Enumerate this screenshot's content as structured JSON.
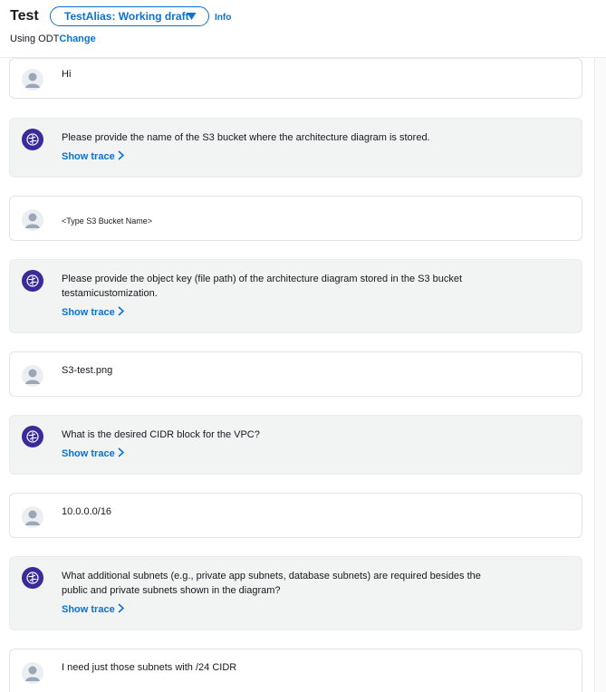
{
  "header": {
    "title": "Test",
    "alias_selected": "TestAlias: Working draft",
    "info_label": "Info",
    "using_prefix": "Using ODT",
    "change_label": "Change"
  },
  "colors": {
    "accent": "#0972d3",
    "agent_bubble": "#f2f3f3",
    "bot_avatar": "#3b2a99"
  },
  "icons": {
    "user_avatar": "user-avatar-icon",
    "bot_avatar": "agent-brain-icon",
    "trace_chevron": "chevron-right-icon",
    "dropdown_caret": "caret-down-icon"
  },
  "messages": [
    {
      "role": "user",
      "text": "Hi"
    },
    {
      "role": "agent",
      "text": "Please provide the name of the S3 bucket where the architecture diagram is stored.",
      "trace": "Show trace"
    },
    {
      "role": "user",
      "text": "<Type S3 Bucket Name>"
    },
    {
      "role": "agent",
      "text": "Please provide the object key (file path) of the architecture diagram stored in the S3 bucket testamicustomization.",
      "trace": "Show trace"
    },
    {
      "role": "user",
      "text": "S3-test.png"
    },
    {
      "role": "agent",
      "text": "What is the desired CIDR block for the VPC?",
      "trace": "Show trace"
    },
    {
      "role": "user",
      "text": "10.0.0.0/16"
    },
    {
      "role": "agent",
      "text": "What additional subnets (e.g., private app subnets, database subnets) are required besides the public and private subnets shown in the diagram?",
      "trace": "Show trace"
    },
    {
      "role": "user",
      "text": "I need just those subnets with /24 CIDR"
    }
  ]
}
